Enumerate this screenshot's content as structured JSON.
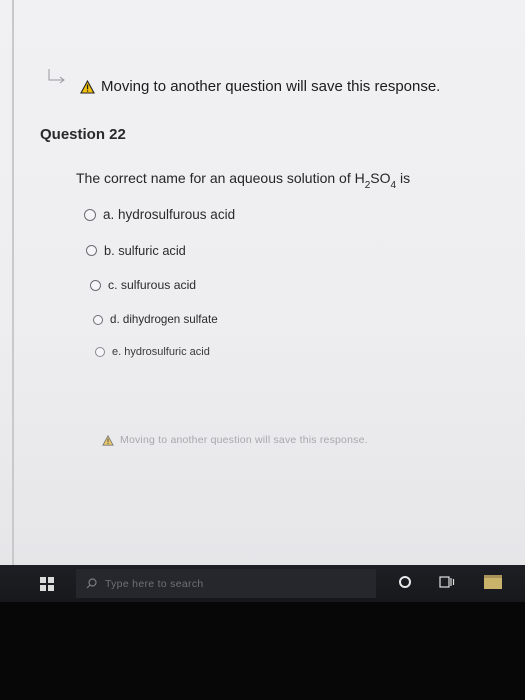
{
  "warning": {
    "text": "Moving to another question will save this response.",
    "icon": "warning-triangle-icon"
  },
  "question": {
    "title": "Question 22",
    "text_before": "The correct name for an aqueous solution of H",
    "sub1": "2",
    "text_mid": "SO",
    "sub2": "4",
    "text_after": " is"
  },
  "options": [
    {
      "label": "a. hydrosulfurous acid"
    },
    {
      "label": "b. sulfuric acid"
    },
    {
      "label": "c. sulfurous acid"
    },
    {
      "label": "d. dihydrogen sulfate"
    },
    {
      "label": "e. hydrosulfuric acid"
    }
  ],
  "taskbar": {
    "search_placeholder": "Type here to search"
  },
  "colors": {
    "warning_fill": "#f4c20d",
    "page_bg": "#efeff1",
    "taskbar_bg": "#1b1d21"
  }
}
